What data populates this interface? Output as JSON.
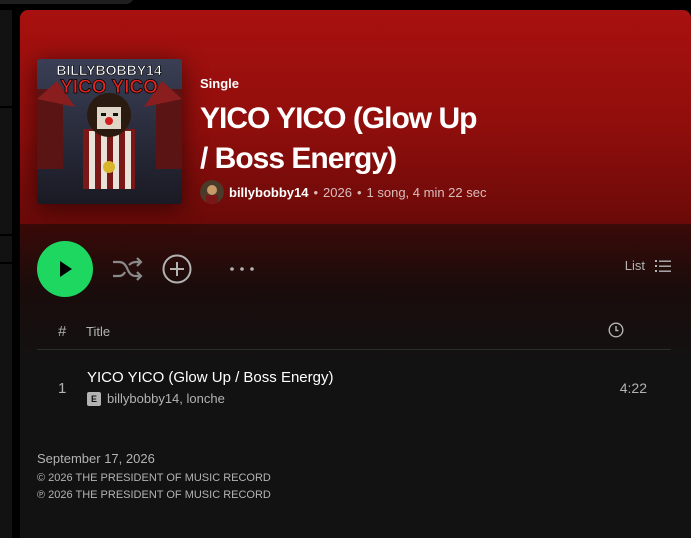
{
  "album": {
    "type_label": "Single",
    "title": "YICO YICO (Glow Up / Boss Energy)",
    "artist": "billybobby14",
    "year": "2026",
    "stats": "1 song, 4 min 22 sec",
    "cover_text_line1": "BILLYBOBBY14",
    "cover_text_line2": "YICO YICO"
  },
  "actions": {
    "view_label": "List"
  },
  "table": {
    "header_index": "#",
    "header_title": "Title"
  },
  "tracks": [
    {
      "index": "1",
      "title": "YICO YICO (Glow Up / Boss Energy)",
      "explicit_badge": "E",
      "artists": "billybobby14, lonche",
      "duration": "4:22"
    }
  ],
  "footer": {
    "release_date": "September 17, 2026",
    "copyright": "© 2026 THE PRESIDENT OF MUSIC RECORD",
    "phonogram": "℗ 2026 THE PRESIDENT OF MUSIC RECORD"
  },
  "colors": {
    "hero_red": "#a8110f",
    "play_green": "#1ed760",
    "background": "#121212",
    "muted_text": "#b3b3b3"
  },
  "icons": [
    "play-icon",
    "shuffle-icon",
    "add-circle-icon",
    "more-options-icon",
    "list-view-icon",
    "clock-icon"
  ]
}
